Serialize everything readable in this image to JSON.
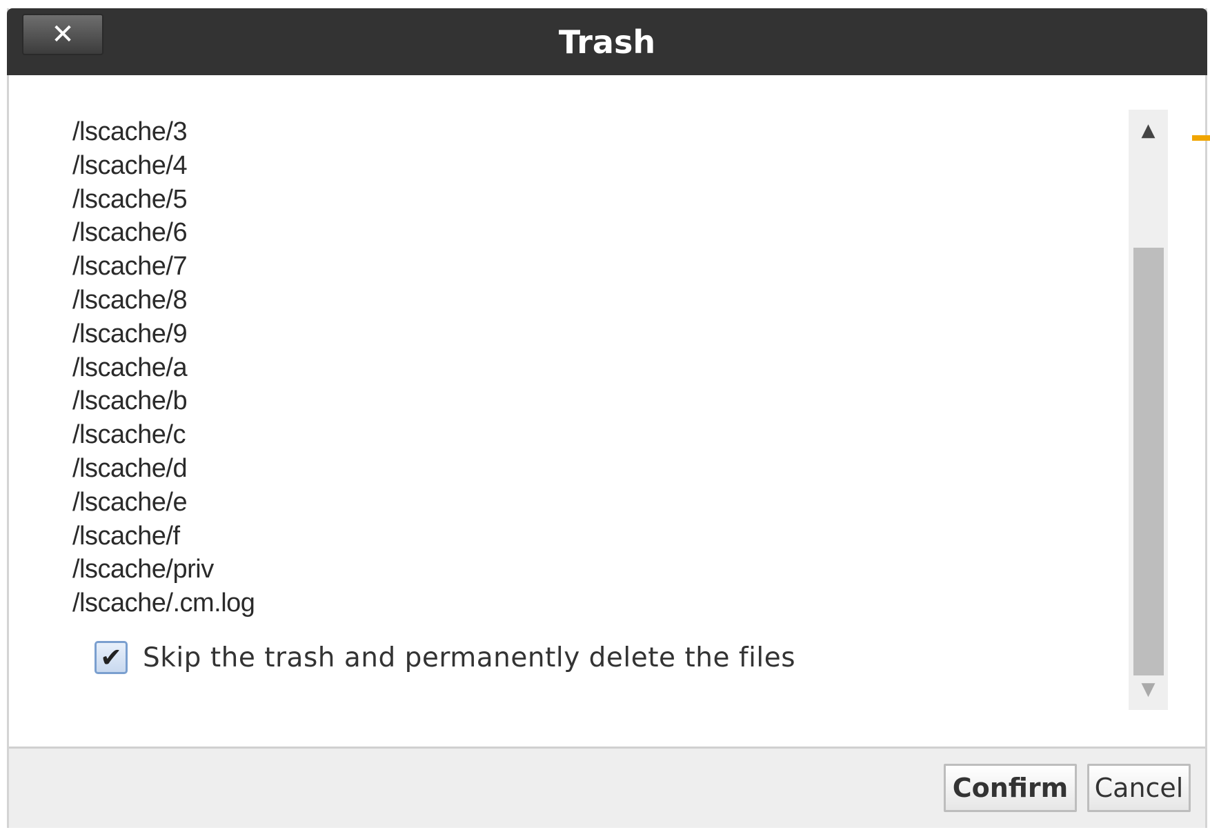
{
  "dialog": {
    "title": "Trash",
    "close_glyph": "✕",
    "files": [
      "/lscache/3",
      "/lscache/4",
      "/lscache/5",
      "/lscache/6",
      "/lscache/7",
      "/lscache/8",
      "/lscache/9",
      "/lscache/a",
      "/lscache/b",
      "/lscache/c",
      "/lscache/d",
      "/lscache/e",
      "/lscache/f",
      "/lscache/priv",
      "/lscache/.cm.log"
    ],
    "skip_trash": {
      "label": "Skip the trash and permanently delete the files",
      "checked": true
    },
    "buttons": {
      "confirm": "Confirm",
      "cancel": "Cancel"
    },
    "scrollbar": {
      "up_icon": "triangle-up-icon",
      "down_icon": "triangle-down-icon"
    }
  },
  "colors": {
    "titlebar": "#333333",
    "accent": "#f0a500",
    "checkbox_border": "#7a9fcf"
  }
}
